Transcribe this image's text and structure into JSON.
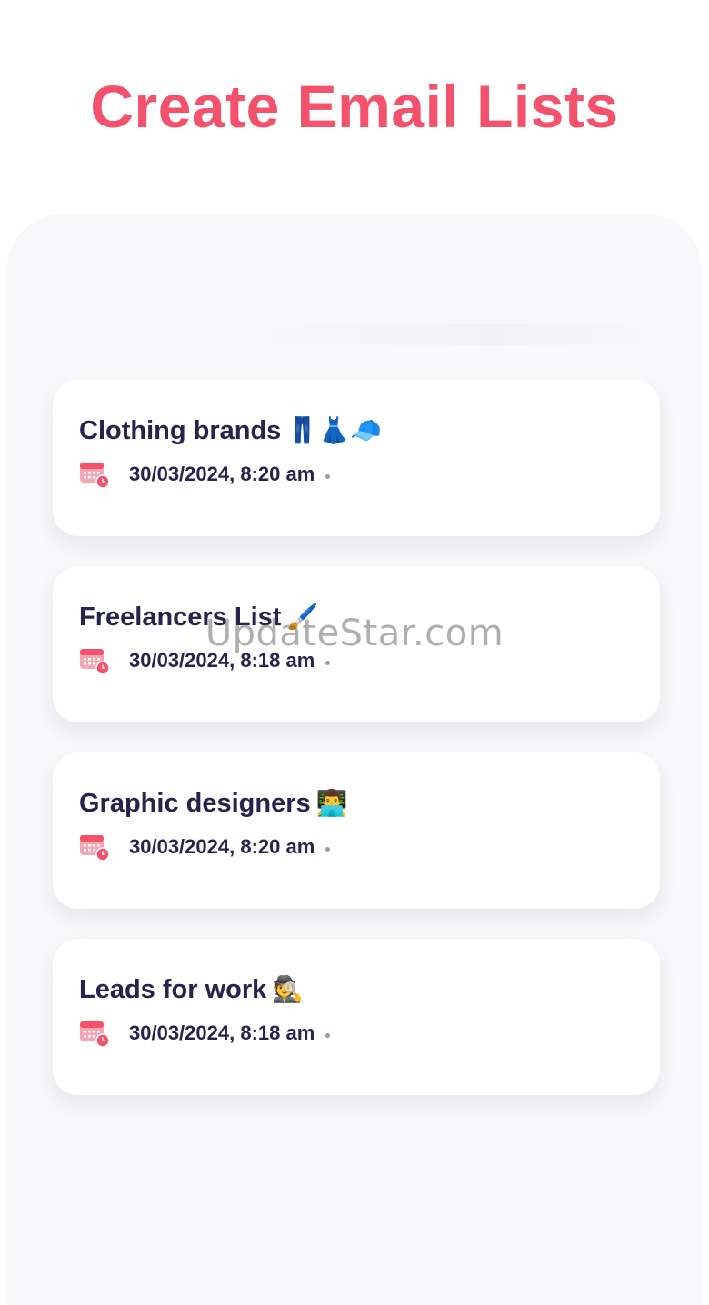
{
  "header": {
    "title": "Create Email Lists"
  },
  "lists": [
    {
      "name": "Clothing brands",
      "emoji": "👖👗🧢",
      "timestamp": "30/03/2024, 8:20 am"
    },
    {
      "name": "Freelancers List",
      "emoji": "🖌️",
      "timestamp": "30/03/2024, 8:18 am"
    },
    {
      "name": "Graphic designers",
      "emoji": "👨‍💻",
      "timestamp": "30/03/2024, 8:20 am"
    },
    {
      "name": "Leads for work",
      "emoji": "🕵️",
      "timestamp": "30/03/2024, 8:18 am"
    }
  ],
  "watermark": "UpdateStar.com",
  "colors": {
    "accent": "#f4516c",
    "text_dark": "#25244e",
    "panel_bg": "#f8f8fa"
  },
  "icons": {
    "date": "calendar-clock-icon"
  }
}
